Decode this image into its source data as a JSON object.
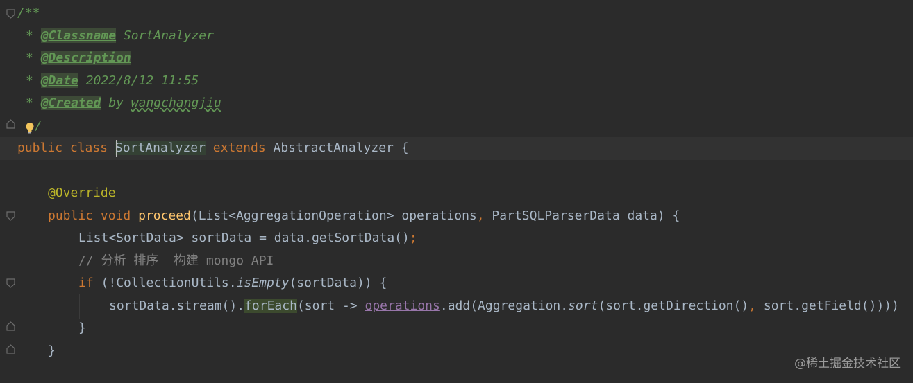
{
  "doc": {
    "open": "/**",
    "star": "*",
    "classname_tag": "@Classname",
    "classname_value": "SortAnalyzer",
    "description_tag": "@Description",
    "date_tag": "@Date",
    "date_value": "2022/8/12 11:55",
    "created_tag": "@Created",
    "created_by": "by",
    "created_author": "wangchangjiu",
    "close": "/"
  },
  "class_decl": {
    "public": "public",
    "class": "class",
    "name": "SortAnalyzer",
    "extends": "extends",
    "parent": "AbstractAnalyzer",
    "brace": "{"
  },
  "override": "@Override",
  "method": {
    "public": "public",
    "void": "void",
    "name": "proceed",
    "params_a": "(List<AggregationOperation> operations",
    "comma": ",",
    "params_b": " PartSQLParserData data) {"
  },
  "body": {
    "line1_a": "List<SortData> sortData = data.getSortData()",
    "line1_semicolon": ";",
    "comment": "// 分析 排序  构建 mongo API",
    "if_kw": "if",
    "if_a": " (!CollectionUtils.",
    "if_isEmpty": "isEmpty",
    "if_b": "(sortData)) {",
    "stream_a": "sortData.stream().",
    "stream_forEach": "forEach",
    "stream_b": "(sort -> ",
    "stream_field": "operations",
    "stream_c": ".add(Aggregation.",
    "stream_sort": "sort",
    "stream_d": "(sort.getDirection()",
    "stream_comma": ",",
    "stream_e": " sort.getField()))",
    "stream_f": ")",
    "close_if": "}",
    "close_method": "}"
  },
  "watermark": "@稀土掘金技术社区"
}
